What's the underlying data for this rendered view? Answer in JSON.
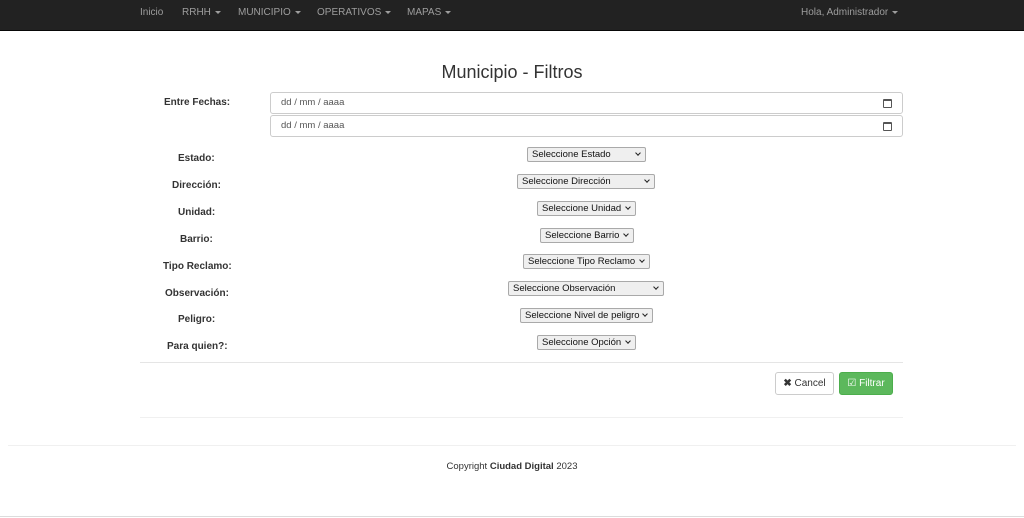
{
  "navbar": {
    "items": [
      {
        "label": "Inicio",
        "dropdown": false
      },
      {
        "label": "RRHH",
        "dropdown": true
      },
      {
        "label": "MUNICIPIO",
        "dropdown": true
      },
      {
        "label": "OPERATIVOS",
        "dropdown": true
      },
      {
        "label": "MAPAS",
        "dropdown": true
      }
    ],
    "user_menu": "Hola, Administrador",
    "background": "#222222"
  },
  "page": {
    "title": "Municipio - Filtros"
  },
  "form": {
    "dates_label": "Entre Fechas:",
    "date_from_placeholder": "dd / mm / aaaa",
    "date_to_placeholder": "dd / mm / aaaa",
    "fields": [
      {
        "label": "Estado:",
        "selected": "Seleccione Estado"
      },
      {
        "label": "Dirección:",
        "selected": "Seleccione Dirección"
      },
      {
        "label": "Unidad:",
        "selected": "Seleccione Unidad"
      },
      {
        "label": "Barrio:",
        "selected": "Seleccione Barrio"
      },
      {
        "label": "Tipo Reclamo:",
        "selected": "Seleccione Tipo Reclamo"
      },
      {
        "label": "Observación:",
        "selected": "Seleccione Observación"
      },
      {
        "label": "Peligro:",
        "selected": "Seleccione Nivel de peligro"
      },
      {
        "label": "Para quien?:",
        "selected": "Seleccione Opción"
      }
    ],
    "cancel_label": "Cancel",
    "submit_label": "Filtrar",
    "submit_color": "#5cb85c"
  },
  "footer": {
    "prefix": "Copyright",
    "brand": "Ciudad Digital",
    "year": "2023"
  }
}
